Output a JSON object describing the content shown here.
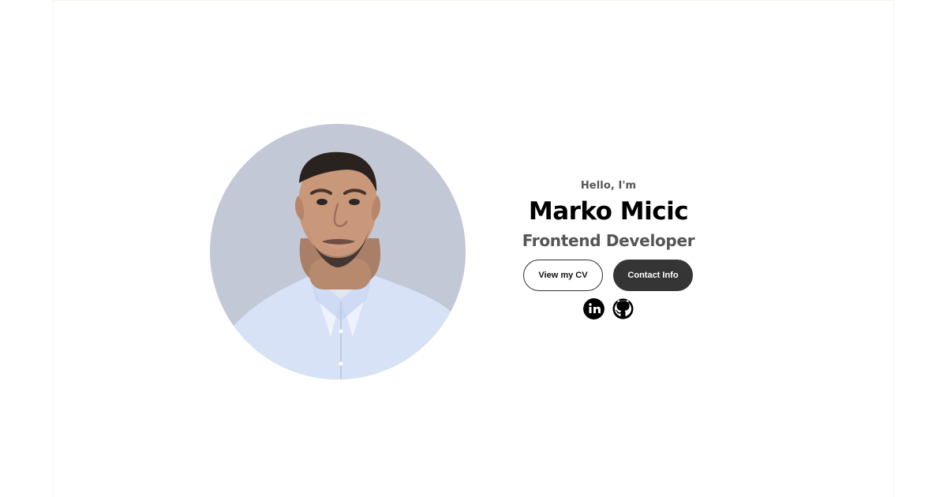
{
  "hero": {
    "greeting": "Hello, I'm",
    "name": "Marko Micic",
    "role": "Frontend Developer"
  },
  "buttons": {
    "cv_label": "View my CV",
    "contact_label": "Contact Info"
  },
  "socials": [
    {
      "icon": "linkedin-icon"
    },
    {
      "icon": "github-icon"
    }
  ],
  "colors": {
    "background": "#ffffff",
    "photo_background": "#c3c8d7",
    "shirt": "#d8e2f7",
    "dark_button": "#353535",
    "subtle_text": "#555555"
  }
}
